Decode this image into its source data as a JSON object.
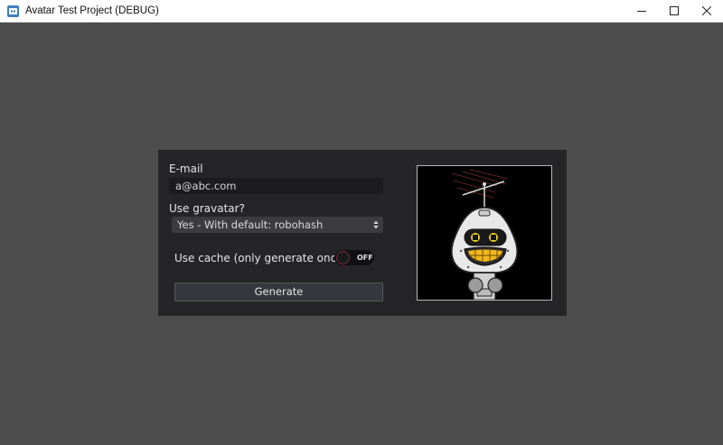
{
  "window": {
    "title": "Avatar Test Project (DEBUG)",
    "controls": [
      "minimize-icon",
      "maximize-icon",
      "close-icon"
    ]
  },
  "form": {
    "email_label": "E-mail",
    "email_value": "a@abc.com",
    "gravatar_label": "Use gravatar?",
    "gravatar_selected": "Yes - With default: robohash",
    "cache_label": "Use cache (only generate once)",
    "cache_toggle_state": "OFF",
    "generate_label": "Generate"
  },
  "avatar": {
    "description_icon": "robot-avatar-image"
  },
  "colors": {
    "background": "#4d4d4d",
    "panel": "#252527",
    "field": "#1c1c1f",
    "select": "#3b3b40",
    "button": "#36373c"
  }
}
